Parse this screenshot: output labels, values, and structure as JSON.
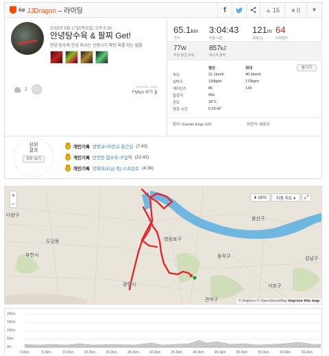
{
  "header": {
    "tier": "èø",
    "title_user": "JJDragon",
    "title_rest": " – 라이딩",
    "kudos_count": "15",
    "comment_count": "0",
    "icons": {
      "facebook": "f",
      "twitter": "♥",
      "share": "<",
      "kudos": "👍",
      "comment": "■",
      "dropdown": "▾"
    }
  },
  "activity": {
    "date": "2015년 9월 17일(목요일) 오후 6:38",
    "name": "안녕탕수육 & 팔찌 Get!",
    "description": "안녕 탕수육 안녕 마시는 신형시기 파란 육를 하는 없음",
    "photo_count": 4
  },
  "social": {
    "kudos_given": "1",
    "strava_labs": "STRAVA LABS",
    "flybys_label": "Flybys 보기 ❯"
  },
  "stats": {
    "distance": {
      "value": "65.1",
      "unit": "km",
      "label": "거리"
    },
    "moving_time": {
      "value": "3:04:43",
      "label": "이동 시간"
    },
    "elevation": {
      "value": "121",
      "unit": "m",
      "label": "고도(↑)"
    },
    "suffer": {
      "value": "64",
      "label": "노력점수"
    },
    "weighted_power": {
      "value": "77",
      "unit": "W",
      "label": "추정 평균 파워"
    },
    "energy": {
      "value": "857",
      "unit": "kJ",
      "label": "에너지 출력"
    }
  },
  "detail_table": {
    "col_avg": "평균",
    "col_max": "최대",
    "more_button": "숨기기",
    "rows": [
      {
        "label": "속도",
        "avg": "21.1km/h",
        "max": "40.3km/h"
      },
      {
        "label": "심박수",
        "avg": "118bpm",
        "max": "170bpm"
      },
      {
        "label": "케이던스",
        "avg": "86",
        "max": "134"
      },
      {
        "label": "칼로리",
        "avg": "956",
        "max": ""
      },
      {
        "label": "온도",
        "avg": "18℃",
        "max": ""
      },
      {
        "label": "경과 시간",
        "avg": "5:23:42",
        "max": ""
      }
    ],
    "device": "장치: Garmin Edge 520",
    "bike": "자전거: 에포이"
  },
  "achievements": {
    "rank_title_line1": "상위",
    "rank_title_line2": "결과",
    "view_all": "모두 보기",
    "items": [
      {
        "prefix": "개인기록",
        "segment": "광명교>하안교 출근길",
        "time": "(7:43)"
      },
      {
        "prefix": "개인기록",
        "segment": "안양천 합수부-구일역",
        "time": "(21:42)"
      },
      {
        "prefix": "개인기록",
        "segment": "양화대교(남-북) 스프린트",
        "time": "(4:36)"
      }
    ]
  },
  "map": {
    "zoom_in": "+",
    "zoom_out": "−",
    "gpx_label": "⬇ GPX",
    "map_type_label": "지형 지도 ▾",
    "fullscreen_icon": "⤢",
    "attribution_pre": "© Mapbox © OpenStreetMap ",
    "attribution_link": "Improve this map",
    "places": {
      "yangcheon": "다양구",
      "dodang": "도당동",
      "bucheon": "부천시",
      "gwangmyeong": "광명시",
      "yeongdeungpo": "영등포구",
      "dongjak": "동작구",
      "yongsan": "용산구",
      "gangnam": "강남구",
      "seocho": "서초구",
      "gwanak": "관악구"
    }
  },
  "elevation_chart": {
    "y_ticks": [
      "200m",
      "150m",
      "100m",
      "50m",
      "0m"
    ],
    "x_ticks": [
      "0.0km",
      "5.0km",
      "10.0km",
      "15.0km",
      "20.0km",
      "25.0km",
      "30.0km",
      "35.0km",
      "40.0km",
      "45.0km",
      "50.0km",
      "55.0km",
      "60.0km",
      "65.0km"
    ]
  },
  "colors": {
    "strava_orange": "#fc4c02",
    "route_red": "#e8242b",
    "link_blue": "#2b7bc0",
    "water": "#6fb7e0"
  }
}
